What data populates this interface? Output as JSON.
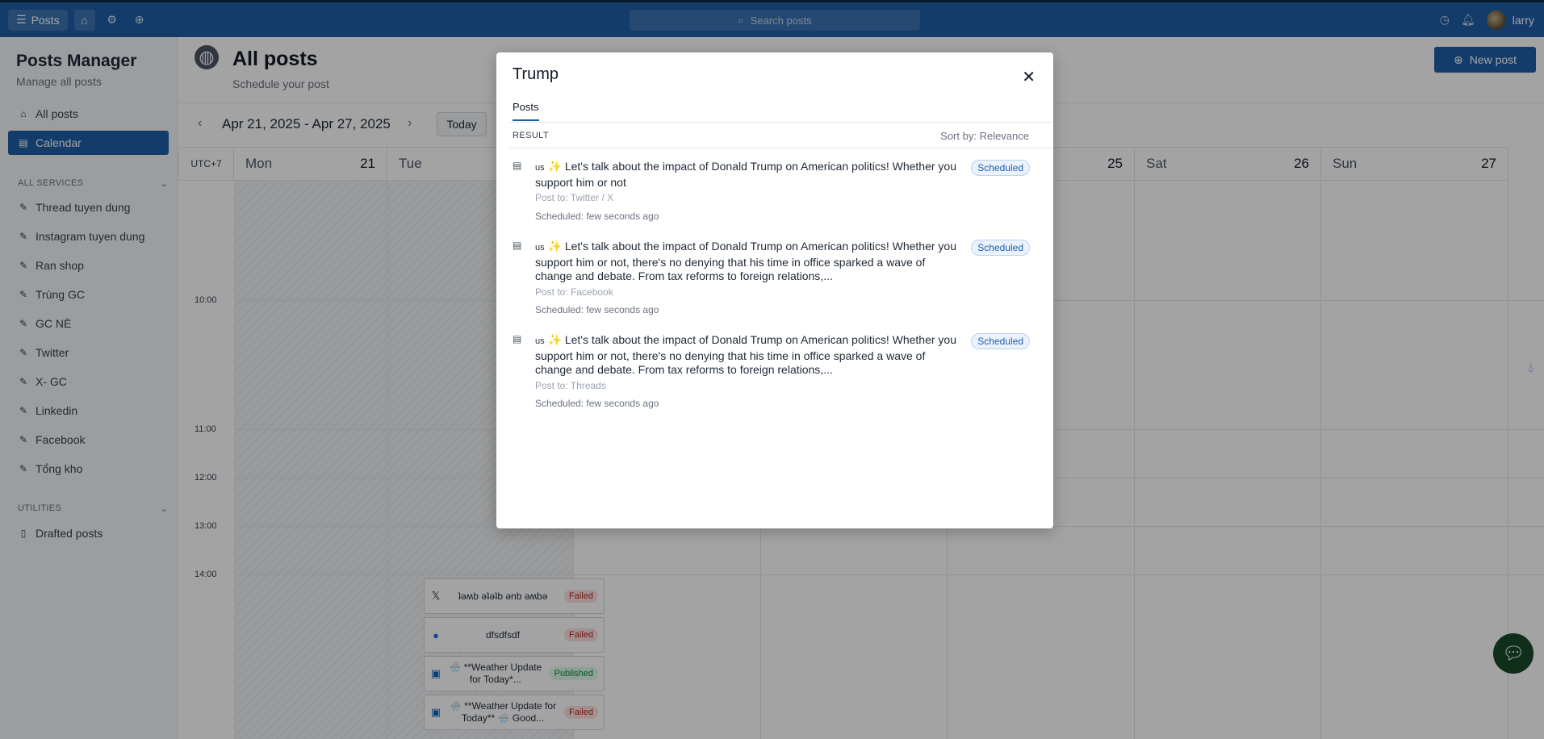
{
  "topbar": {
    "app_label": "Posts",
    "search_placeholder": "Search posts",
    "user_name": "larry"
  },
  "sidebar": {
    "title": "Posts Manager",
    "subtitle": "Manage all posts",
    "nav": [
      {
        "label": "All posts"
      },
      {
        "label": "Calendar"
      }
    ],
    "services_header": "ALL SERVICES",
    "services": [
      {
        "label": "Thread tuyen dung"
      },
      {
        "label": "Instagram tuyen dung"
      },
      {
        "label": "Ran shop"
      },
      {
        "label": "Trùng GC"
      },
      {
        "label": "GC NÈ"
      },
      {
        "label": "Twitter"
      },
      {
        "label": "X- GC"
      },
      {
        "label": "Linkedin"
      },
      {
        "label": "Facebook"
      },
      {
        "label": "Tổng kho"
      }
    ],
    "utilities_header": "UTILITIES",
    "utilities": [
      {
        "label": "Drafted posts"
      }
    ]
  },
  "header": {
    "title": "All posts",
    "subtitle": "Schedule your post",
    "new_post": "New post"
  },
  "calendar": {
    "range": "Apr 21, 2025 - Apr 27, 2025",
    "today": "Today",
    "timezone": "UTC+7",
    "days": [
      {
        "name": "Mon",
        "num": "21"
      },
      {
        "name": "Tue",
        "num": ""
      },
      {
        "name": "",
        "num": ""
      },
      {
        "name": "",
        "num": ""
      },
      {
        "name": "",
        "num": "25"
      },
      {
        "name": "Sat",
        "num": "26"
      },
      {
        "name": "Sun",
        "num": "27"
      }
    ],
    "times": [
      "10:00",
      "11:00",
      "12:00",
      "13:00",
      "14:00"
    ],
    "events": [
      {
        "icon": "x-icon",
        "text": "ʇəʍb əʇəʇb ǝnb ǝʍbǝ",
        "status": "Failed"
      },
      {
        "icon": "facebook-icon",
        "text": "dfsdfsdf",
        "status": "Failed"
      },
      {
        "icon": "linkedin-icon",
        "text": "🌧️ **Weather Update for Today*...",
        "status": "Published"
      },
      {
        "icon": "linkedin-icon",
        "text": "🌧️ **Weather Update for Today** 🌧️ Good...",
        "status": "Failed"
      }
    ]
  },
  "modal": {
    "title": "Trump",
    "tab": "Posts",
    "result_label": "RESULT",
    "sort": "Sort by: Relevance",
    "results": [
      {
        "flag": "us",
        "text": "Let's talk about the impact of Donald Trump on American politics! Whether you support him or not",
        "post_to": "Post to: Twitter / X",
        "scheduled": "Scheduled: few seconds ago",
        "status": "Scheduled"
      },
      {
        "flag": "us",
        "text": "Let's talk about the impact of Donald Trump on American politics! Whether you support him or not, there's no denying that his time in office sparked a wave of change and debate. From tax reforms to foreign relations,...",
        "post_to": "Post to: Facebook",
        "scheduled": "Scheduled: few seconds ago",
        "status": "Scheduled"
      },
      {
        "flag": "us",
        "text": "Let's talk about the impact of Donald Trump on American politics! Whether you support him or not, there's no denying that his time in office sparked a wave of change and debate. From tax reforms to foreign relations,...",
        "post_to": "Post to: Threads",
        "scheduled": "Scheduled: few seconds ago",
        "status": "Scheduled"
      }
    ]
  }
}
